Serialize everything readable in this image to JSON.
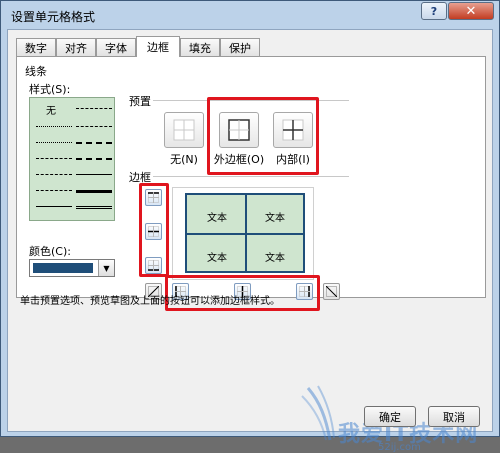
{
  "window": {
    "title": "设置单元格格式",
    "help": "?",
    "close": "✕"
  },
  "tabs": [
    {
      "label": "数字"
    },
    {
      "label": "对齐"
    },
    {
      "label": "字体"
    },
    {
      "label": "边框",
      "active": true
    },
    {
      "label": "填充"
    },
    {
      "label": "保护"
    }
  ],
  "line": {
    "section_label": "线条",
    "style_label": "样式(S):",
    "none_label": "无",
    "color_label": "颜色(C):",
    "color_value": "#1f4e79"
  },
  "presets": {
    "section_label": "预置",
    "items": [
      {
        "label": "无(N)"
      },
      {
        "label": "外边框(O)"
      },
      {
        "label": "内部(I)"
      }
    ]
  },
  "border": {
    "section_label": "边框",
    "cells": [
      "文本",
      "文本",
      "文本",
      "文本"
    ]
  },
  "hint": "单击预置选项、预览草图及上面的按钮可以添加边框样式。",
  "buttons": {
    "ok": "确定",
    "cancel": "取消"
  },
  "watermark": {
    "text": "我爱IT技术网",
    "sub": "52ij.com"
  },
  "colors": {
    "highlight": "#e0151e",
    "border_blue": "#1f4e79",
    "cell_green": "#cfe5cf"
  }
}
